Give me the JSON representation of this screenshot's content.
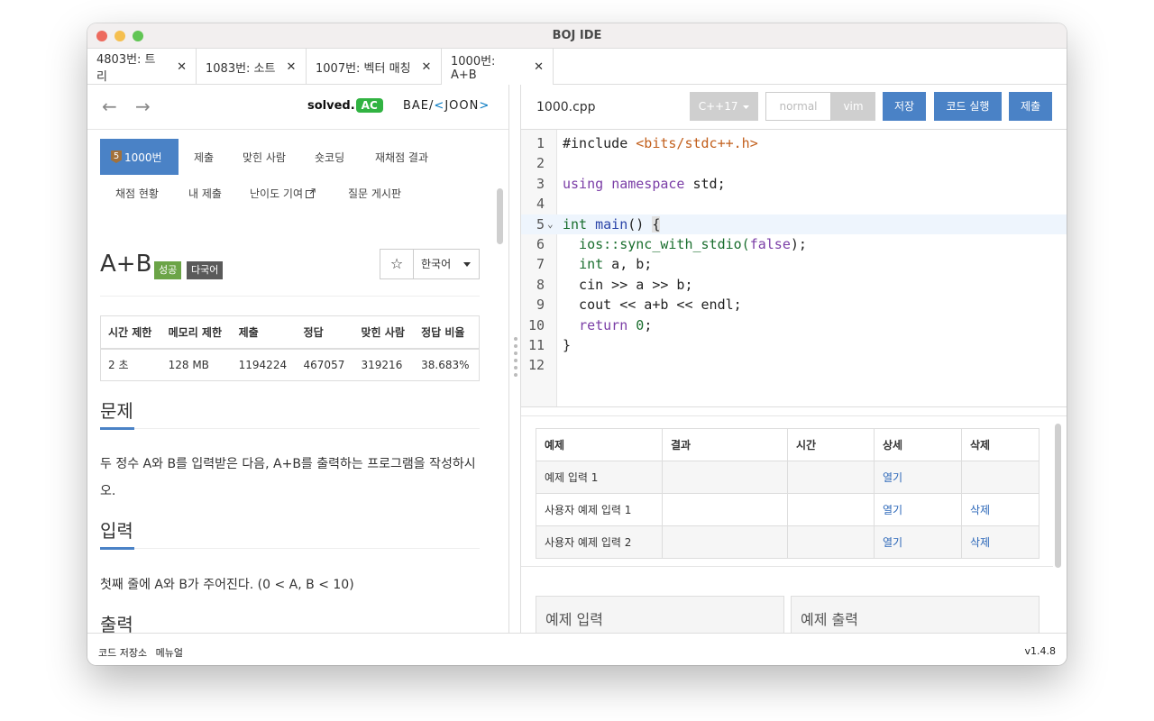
{
  "window": {
    "title": "BOJ IDE"
  },
  "tabs": [
    {
      "label": "4803번: 트리",
      "close": "✕"
    },
    {
      "label": "1083번: 소트",
      "close": "✕"
    },
    {
      "label": "1007번: 벡터 매칭",
      "close": "✕"
    },
    {
      "label": "1000번: A+B",
      "close": "✕"
    }
  ],
  "nav": {
    "back": "←",
    "forward": "→",
    "solved_text": "solved.",
    "solved_badge": "AC",
    "baekjoon_prefix": "BAE/",
    "baekjoon_mark": "<",
    "baekjoon_suffix": "JOON",
    "baekjoon_end": ">"
  },
  "problem_tabs": {
    "medal": "5",
    "items": [
      "1000번",
      "제출",
      "맞힌 사람",
      "숏코딩",
      "재채점 결과",
      "채점 현황",
      "내 제출",
      "난이도 기여",
      "질문 게시판"
    ]
  },
  "problem": {
    "title": "A+B",
    "badges": [
      "성공",
      "다국어"
    ],
    "star": "☆",
    "language": "한국어",
    "info_headers": [
      "시간 제한",
      "메모리 제한",
      "제출",
      "정답",
      "맞힌 사람",
      "정답 비율"
    ],
    "info_values": [
      "2 초",
      "128 MB",
      "1194224",
      "467057",
      "319216",
      "38.683%"
    ],
    "sections": {
      "desc_title": "문제",
      "desc": "두 정수 A와 B를 입력받은 다음, A+B를 출력하는 프로그램을 작성하시오.",
      "input_title": "입력",
      "input": "첫째 줄에 A와 B가 주어진다. (0 < A, B < 10)",
      "output_title": "출력"
    }
  },
  "editor": {
    "filename": "1000.cpp",
    "language": "C++17",
    "mode_normal": "normal",
    "mode_vim": "vim",
    "save": "저장",
    "run": "코드 실행",
    "submit": "제출",
    "fold_marker": "⌄",
    "line_numbers": [
      "1",
      "2",
      "3",
      "4",
      "5",
      "6",
      "7",
      "8",
      "9",
      "10",
      "11",
      "12"
    ],
    "code": {
      "l1a": "#include ",
      "l1b": "<bits/stdc++.h>",
      "l3a": "using",
      "l3b": "namespace",
      "l3c": " std;",
      "l5a": "int",
      "l5b": "main",
      "l5c": "() ",
      "l5d": "{",
      "l6a": "  ios::sync_with_stdio(",
      "l6b": "false",
      "l6c": ");",
      "l7a": "int",
      "l7b": " a, b;",
      "l8": "  cin >> a >> b;",
      "l9": "  cout << a+b << endl;",
      "l10a": "return",
      "l10b": "0",
      "l10c": ";",
      "l11": "}"
    }
  },
  "testcases": {
    "headers": [
      "예제",
      "결과",
      "시간",
      "상세",
      "삭제"
    ],
    "rows": [
      {
        "name": "예제 입력 1",
        "detail": "열기",
        "delete": ""
      },
      {
        "name": "사용자 예제 입력 1",
        "detail": "열기",
        "delete": "삭제"
      },
      {
        "name": "사용자 예제 입력 2",
        "detail": "열기",
        "delete": "삭제"
      }
    ],
    "input_panel": "예제 입력",
    "output_panel": "예제 출력"
  },
  "status": {
    "items": [
      "코드 저장소",
      "메뉴얼"
    ],
    "version": "v1.4.8"
  },
  "colors": {
    "accent": "#4a82c6",
    "success": "#6ba447",
    "ac_green": "#31b342"
  }
}
